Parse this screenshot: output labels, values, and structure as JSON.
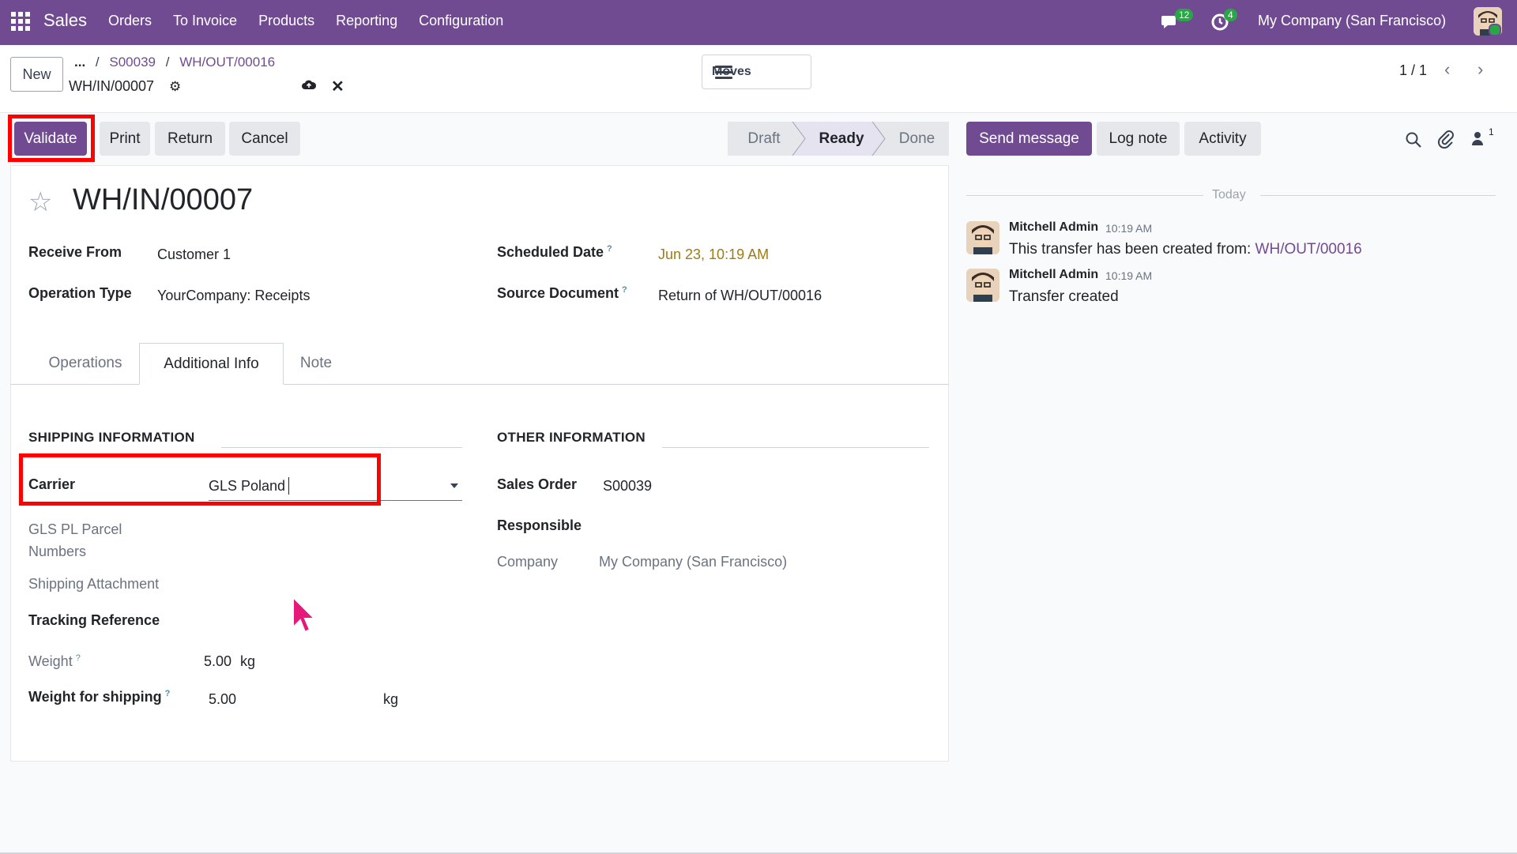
{
  "navbar": {
    "app_name": "Sales",
    "menu": [
      "Orders",
      "To Invoice",
      "Products",
      "Reporting",
      "Configuration"
    ],
    "chat_badge": "12",
    "activity_badge": "4",
    "company": "My Company (San Francisco)"
  },
  "control": {
    "new_label": "New",
    "breadcrumb_dots": "...",
    "breadcrumb": [
      "S00039",
      "WH/OUT/00016"
    ],
    "record_name": "WH/IN/00007",
    "moves_label": "Moves",
    "pager": "1 / 1"
  },
  "actions": {
    "validate": "Validate",
    "print": "Print",
    "return": "Return",
    "cancel": "Cancel"
  },
  "status": {
    "stages": [
      "Draft",
      "Ready",
      "Done"
    ],
    "active": "Ready"
  },
  "chatter_buttons": {
    "send": "Send message",
    "log": "Log note",
    "activity": "Activity",
    "followers": "1"
  },
  "form": {
    "title": "WH/IN/00007",
    "receive_from_label": "Receive From",
    "receive_from": "Customer 1",
    "operation_type_label": "Operation Type",
    "operation_type": "YourCompany: Receipts",
    "scheduled_date_label": "Scheduled Date",
    "scheduled_date": "Jun 23, 10:19 AM",
    "source_document_label": "Source Document",
    "source_document": "Return of WH/OUT/00016",
    "tooltip_mark": "?",
    "tabs": [
      "Operations",
      "Additional Info",
      "Note"
    ],
    "shipping": {
      "header": "SHIPPING INFORMATION",
      "carrier_label": "Carrier",
      "carrier": "GLS Poland",
      "gls_label_line1": "GLS PL Parcel",
      "gls_label_line2": "Numbers",
      "attachment_label": "Shipping Attachment",
      "tracking_label": "Tracking Reference",
      "weight_label": "Weight",
      "weight": "5.00",
      "weight_unit": "kg",
      "weight_shipping_label": "Weight for shipping",
      "weight_shipping": "5.00",
      "weight_shipping_unit": "kg"
    },
    "other": {
      "header": "OTHER INFORMATION",
      "sales_order_label": "Sales Order",
      "sales_order": "S00039",
      "responsible_label": "Responsible",
      "company_label": "Company",
      "company": "My Company (San Francisco)"
    }
  },
  "chatter": {
    "today": "Today",
    "messages": [
      {
        "author": "Mitchell Admin",
        "time": "10:19 AM",
        "text": "This transfer has been created from: ",
        "link": "WH/OUT/00016"
      },
      {
        "author": "Mitchell Admin",
        "time": "10:19 AM",
        "text": "Transfer created"
      }
    ]
  },
  "colors": {
    "brand": "#714b92",
    "highlight": "#ff0000",
    "badge": "#28a745",
    "date": "#a07a14"
  }
}
